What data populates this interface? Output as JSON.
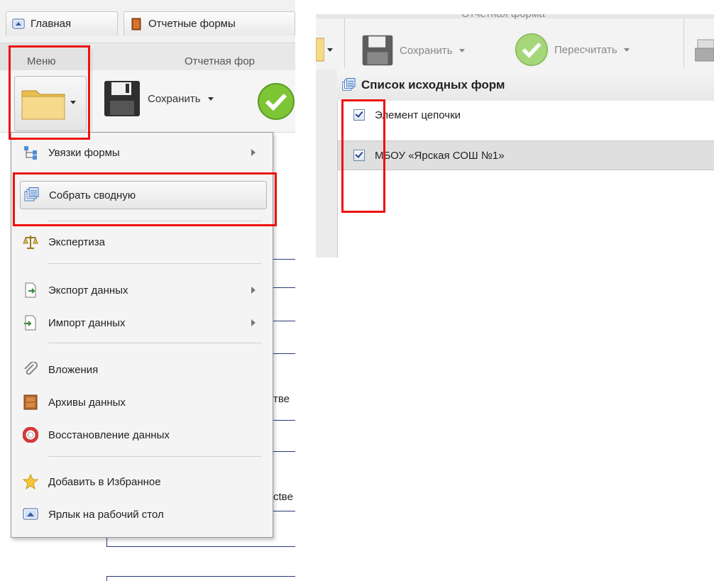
{
  "left_panel": {
    "tabs": [
      {
        "label": "Главная",
        "icon": "home-screen-icon"
      },
      {
        "label": "Отчетные формы",
        "icon": "book-icon"
      }
    ],
    "ribbon": {
      "menu_group_label": "Меню",
      "form_group_label": "Отчетная фор",
      "save_label": "Сохранить"
    },
    "menu": {
      "items": [
        {
          "label": "Увязки формы",
          "icon": "links-icon",
          "submenu": true
        },
        {
          "label": "Собрать сводную",
          "icon": "collect-summary-icon",
          "submenu": false,
          "highlighted": true
        },
        {
          "label": "Экспертиза",
          "icon": "scales-icon",
          "submenu": false
        },
        {
          "label": "Экспорт данных",
          "icon": "export-icon",
          "submenu": true
        },
        {
          "label": "Импорт данных",
          "icon": "import-icon",
          "submenu": true
        },
        {
          "label": "Вложения",
          "icon": "paperclip-icon",
          "submenu": false
        },
        {
          "label": "Архивы данных",
          "icon": "archive-cabinet-icon",
          "submenu": false
        },
        {
          "label": "Восстановление данных",
          "icon": "lifebuoy-icon",
          "submenu": false
        },
        {
          "label": "Добавить в Избранное",
          "icon": "star-icon",
          "submenu": false
        },
        {
          "label": "Ярлык на рабочий стол",
          "icon": "shortcut-icon",
          "submenu": false
        }
      ]
    },
    "background_fragments": [
      "тве",
      "ctвe"
    ]
  },
  "right_panel": {
    "ribbon": {
      "group_label": "Отчетная форма",
      "save_label": "Сохранить",
      "recalc_label": "Пересчитать"
    },
    "window_title": "Список исходных форм",
    "rows": [
      {
        "label": "Элемент цепочки",
        "checked": true
      },
      {
        "label": "МБОУ «Ярская СОШ №1»",
        "checked": true,
        "selected": true
      }
    ]
  },
  "colors": {
    "highlight_red": "#ee1111",
    "checkbox_blue": "#1f3f9a",
    "folder_yellow": "#f2d37a",
    "save_green": "#7ec536"
  }
}
